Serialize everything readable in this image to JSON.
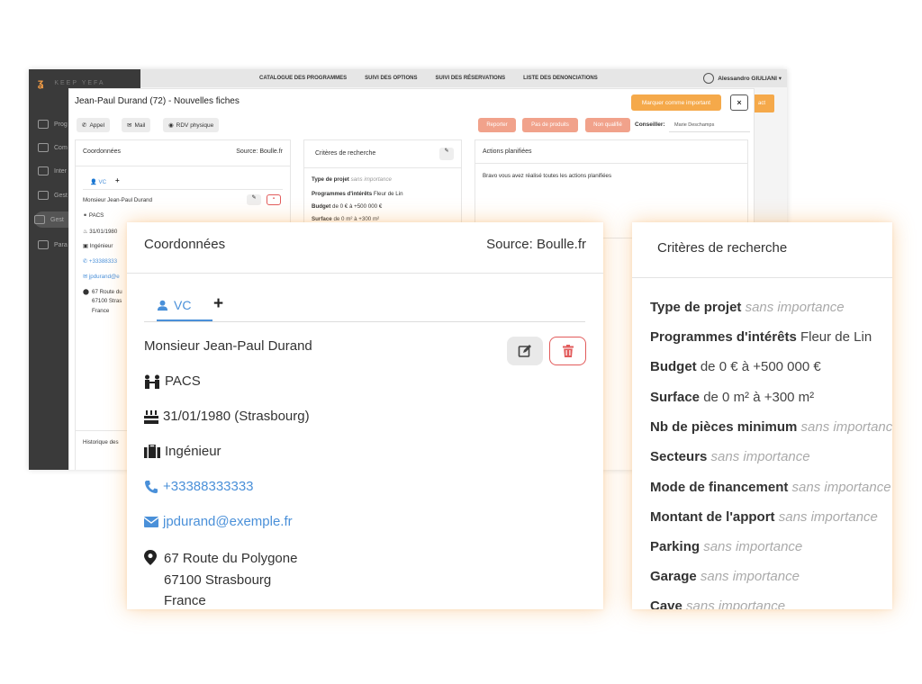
{
  "bg": {
    "logo_text": "KEEP YEFA",
    "sidebar_items": [
      "Prog",
      "Com",
      "Inter",
      "Gest",
      "Gest",
      "Para"
    ],
    "nav": [
      "CATALOGUE DES PROGRAMMES",
      "SUIVI DES OPTIONS",
      "SUIVI DES RÉSERVATIONS",
      "LISTE DES DENONCIATIONS"
    ],
    "user": "Alessandro GIULIANI ▾",
    "orange_right": "act",
    "modal_title": "Jean-Paul Durand (72) - Nouvelles fiches",
    "mark_button": "Marquer comme important",
    "close": "×",
    "chips": [
      "Appel",
      "Mail",
      "RDV physique"
    ],
    "red_buttons": [
      "Reporter",
      "Pas de produits",
      "Non qualifié"
    ],
    "conseiller_label": "Conseiller:",
    "conseiller_value": "Marie Deschamps",
    "coords_title": "Coordonnées",
    "coords_source": "Source: Boulle.fr",
    "tab_vc": "VC",
    "tab_plus": "+",
    "name": "Monsieur Jean-Paul Durand",
    "pacs": "PACS",
    "birth": "31/01/1980",
    "job": "Ingénieur",
    "phone": "+33388333",
    "email": "jpdurand@e",
    "addr1": "67 Route du",
    "addr2": "67100 Stras",
    "addr3": "France",
    "history": "Historique des",
    "criteria_title": "Critères de recherche",
    "crit_rows": [
      {
        "k": "Type de projet",
        "v": "sans importance"
      },
      {
        "k": "Programmes d'intérêts",
        "v": "Fleur de Lin"
      },
      {
        "k": "Budget",
        "v": "de 0 € à +500 000 €"
      },
      {
        "k": "Surface",
        "v": "de 0 m² à +300 m²"
      }
    ],
    "actions_title": "Actions planifiées",
    "actions_text": "Bravo vous avez réalisé toutes les actions planifiées"
  },
  "coords": {
    "title": "Coordonnées",
    "source": "Source: Boulle.fr",
    "tab_vc": "VC",
    "tab_plus": "+",
    "name": "Monsieur Jean-Paul Durand",
    "civil_status": "PACS",
    "birth": "31/01/1980 (Strasbourg)",
    "job": "Ingénieur",
    "phone": "+33388333333",
    "email": "jpdurand@exemple.fr",
    "address_line1": "67 Route du Polygone",
    "address_line2": "67100 Strasbourg",
    "address_line3": "France"
  },
  "criteria": {
    "title": "Critères de recherche",
    "rows": [
      {
        "label": "Type de projet",
        "value": "sans importance",
        "unset": true
      },
      {
        "label": "Programmes d'intérêts",
        "value": "Fleur de Lin",
        "unset": false
      },
      {
        "label": "Budget",
        "value": "de 0 € à +500 000 €",
        "unset": false
      },
      {
        "label": "Surface",
        "value": "de 0 m² à +300 m²",
        "unset": false
      },
      {
        "label": "Nb de pièces minimum",
        "value": "sans importance",
        "unset": true
      },
      {
        "label": "Secteurs",
        "value": "sans importance",
        "unset": true
      },
      {
        "label": "Mode de financement",
        "value": "sans importance",
        "unset": true
      },
      {
        "label": "Montant de l'apport",
        "value": "sans importance",
        "unset": true
      },
      {
        "label": "Parking",
        "value": "sans importance",
        "unset": true
      },
      {
        "label": "Garage",
        "value": "sans importance",
        "unset": true
      },
      {
        "label": "Cave",
        "value": "sans importance",
        "unset": true
      }
    ]
  },
  "colors": {
    "accent_blue": "#4a90d9",
    "orange": "#f5a94a",
    "danger": "#e25b5b"
  }
}
